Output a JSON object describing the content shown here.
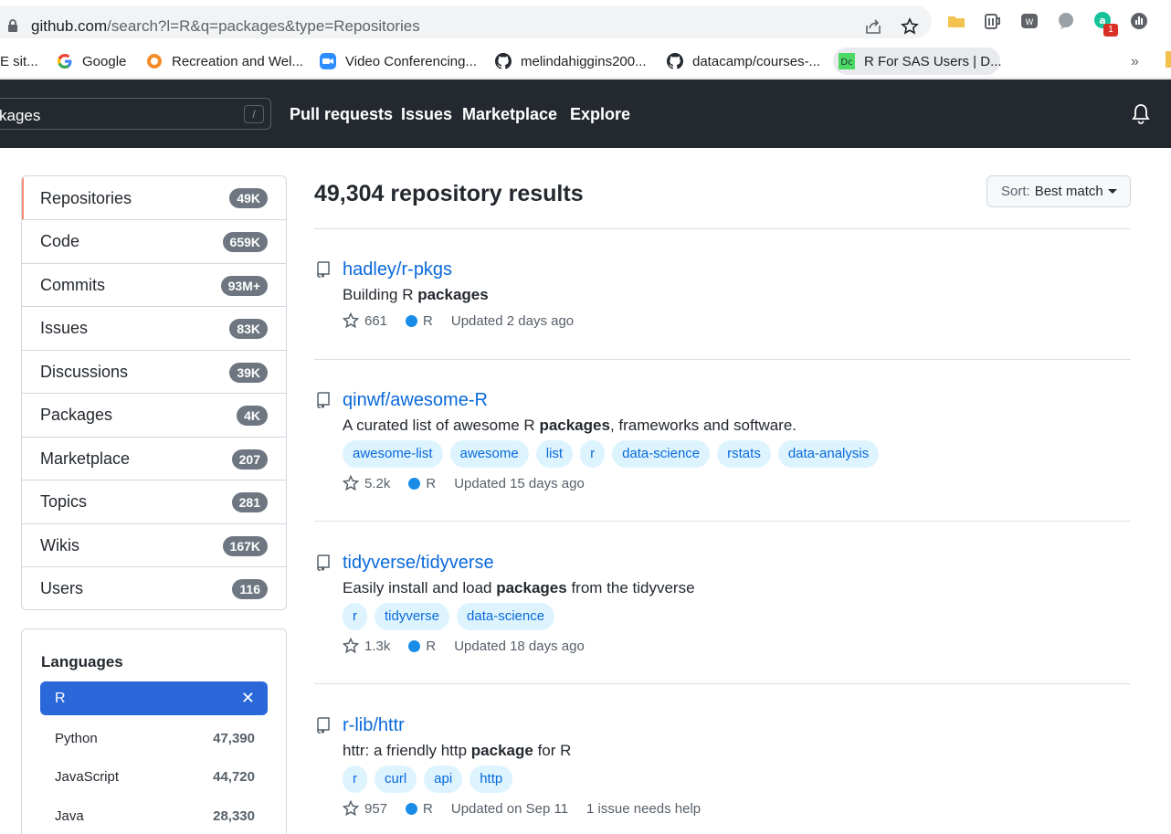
{
  "browser": {
    "url_host": "github.com",
    "url_path": "/search?l=R&q=packages&type=Repositories",
    "bookmarks": [
      {
        "label": "E sit..."
      },
      {
        "label": "Google"
      },
      {
        "label": "Recreation and Wel..."
      },
      {
        "label": "Video Conferencing..."
      },
      {
        "label": "melindahiggins200..."
      },
      {
        "label": "datacamp/courses-..."
      },
      {
        "label": "R For SAS Users | D..."
      }
    ],
    "more_label": "»",
    "ext_badge": "1"
  },
  "header": {
    "search_value": "kages",
    "slash_key": "/",
    "nav": [
      "Pull requests",
      "Issues",
      "Marketplace",
      "Explore"
    ]
  },
  "sidebar": {
    "items": [
      {
        "label": "Repositories",
        "count": "49K"
      },
      {
        "label": "Code",
        "count": "659K"
      },
      {
        "label": "Commits",
        "count": "93M+"
      },
      {
        "label": "Issues",
        "count": "83K"
      },
      {
        "label": "Discussions",
        "count": "39K"
      },
      {
        "label": "Packages",
        "count": "4K"
      },
      {
        "label": "Marketplace",
        "count": "207"
      },
      {
        "label": "Topics",
        "count": "281"
      },
      {
        "label": "Wikis",
        "count": "167K"
      },
      {
        "label": "Users",
        "count": "116"
      }
    ],
    "languages_title": "Languages",
    "selected_language": "R",
    "clear_icon": "✕",
    "languages": [
      {
        "name": "Python",
        "count": "47,390"
      },
      {
        "name": "JavaScript",
        "count": "44,720"
      },
      {
        "name": "Java",
        "count": "28,330"
      }
    ]
  },
  "main": {
    "results_title": "49,304 repository results",
    "sort_label": "Sort:",
    "sort_value": "Best match",
    "repos": [
      {
        "name": "hadley/r-pkgs",
        "desc_before": "Building R ",
        "desc_bold": "packages",
        "desc_after": "",
        "topics": [],
        "stars": "661",
        "language": "R",
        "updated": "Updated 2 days ago",
        "extra": ""
      },
      {
        "name": "qinwf/awesome-R",
        "desc_before": "A curated list of awesome R ",
        "desc_bold": "packages",
        "desc_after": ", frameworks and software.",
        "topics": [
          "awesome-list",
          "awesome",
          "list",
          "r",
          "data-science",
          "rstats",
          "data-analysis"
        ],
        "stars": "5.2k",
        "language": "R",
        "updated": "Updated 15 days ago",
        "extra": ""
      },
      {
        "name": "tidyverse/tidyverse",
        "desc_before": "Easily install and load ",
        "desc_bold": "packages",
        "desc_after": " from the tidyverse",
        "topics": [
          "r",
          "tidyverse",
          "data-science"
        ],
        "stars": "1.3k",
        "language": "R",
        "updated": "Updated 18 days ago",
        "extra": ""
      },
      {
        "name": "r-lib/httr",
        "desc_before": "httr: a friendly http ",
        "desc_bold": "package",
        "desc_after": " for R",
        "topics": [
          "r",
          "curl",
          "api",
          "http"
        ],
        "stars": "957",
        "language": "R",
        "updated": "Updated on Sep 11",
        "extra": "1 issue needs help"
      }
    ]
  }
}
